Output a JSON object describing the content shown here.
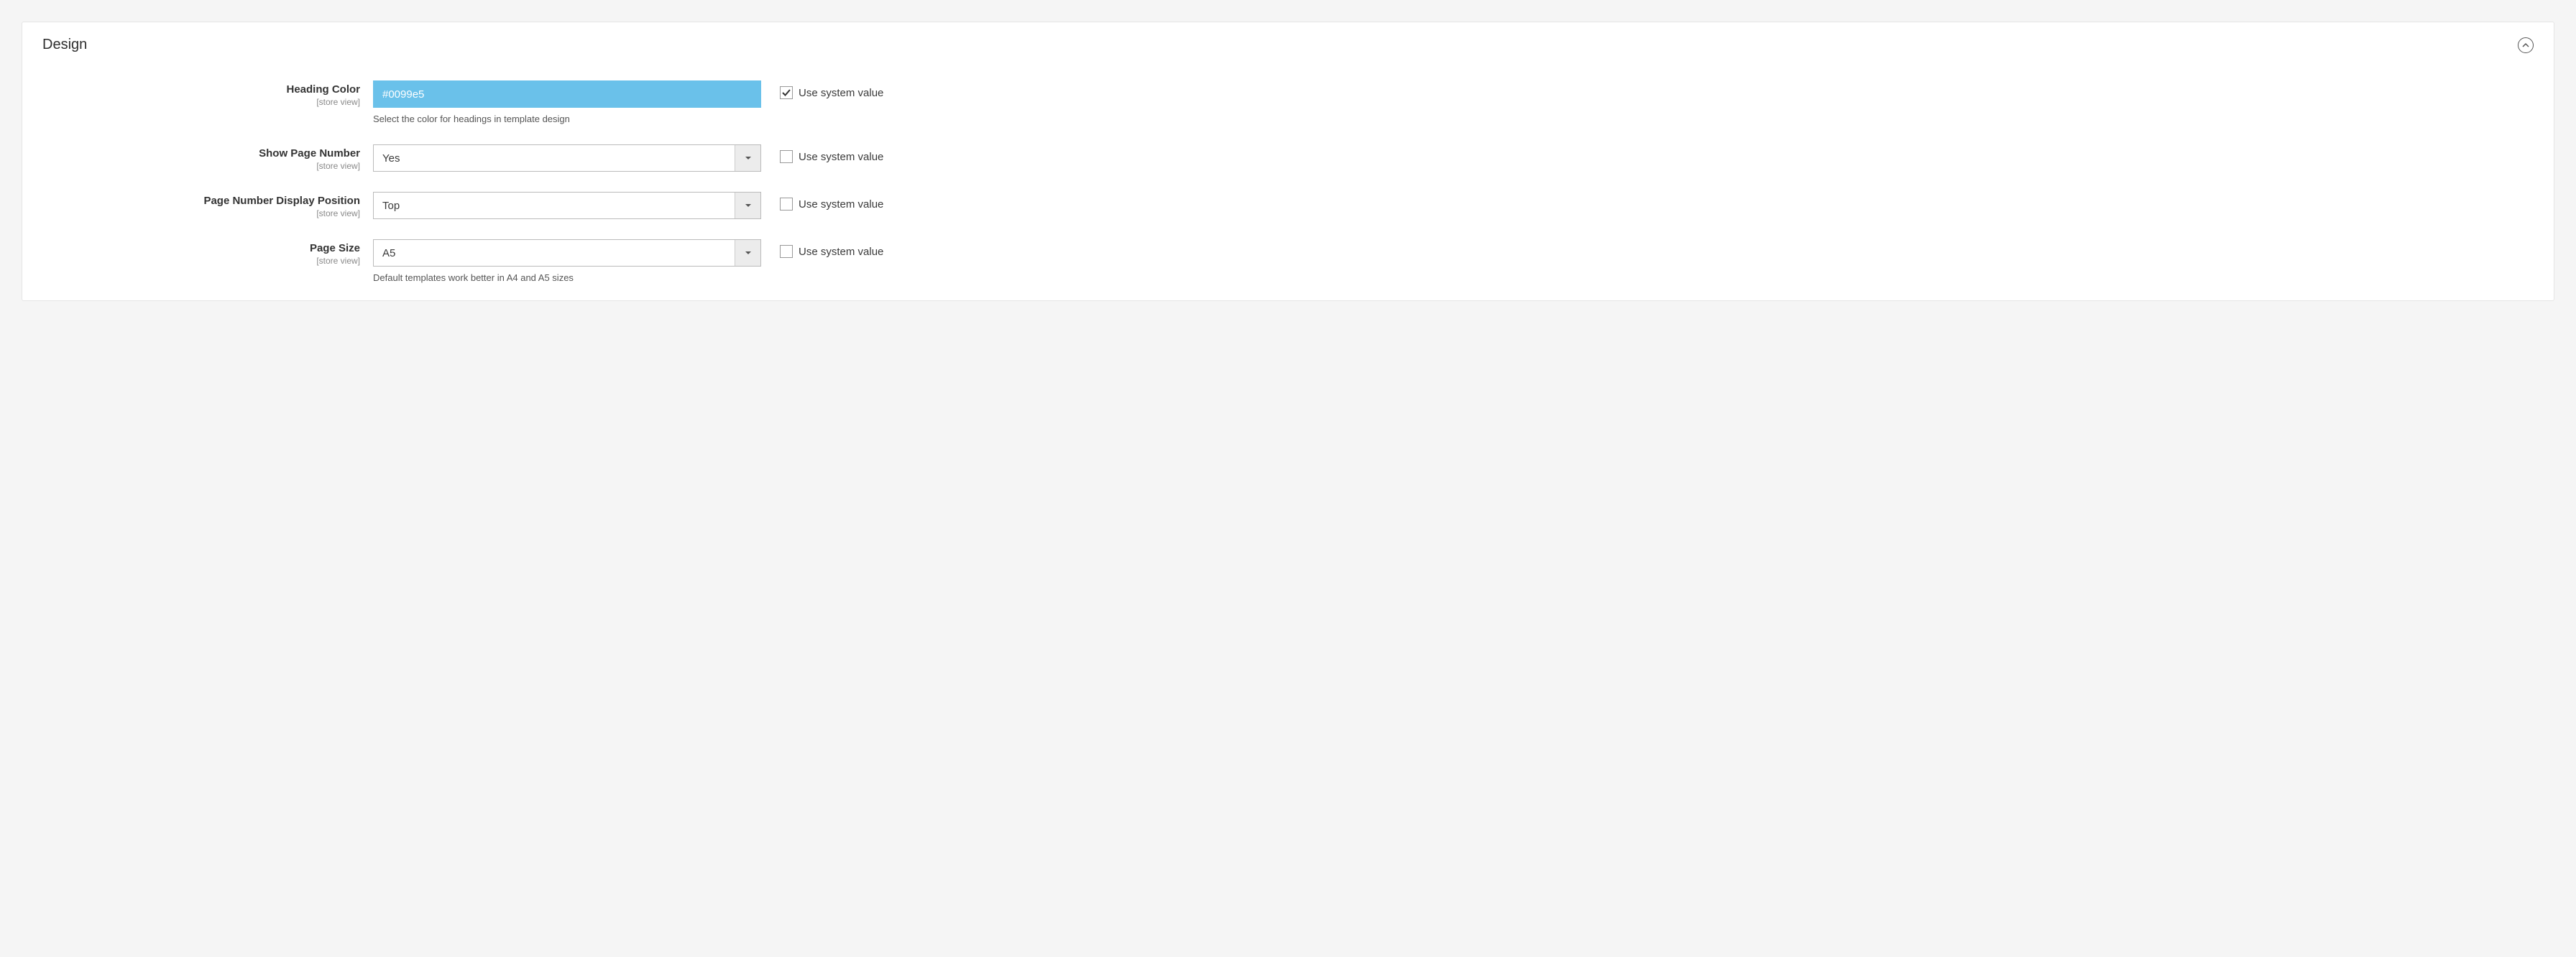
{
  "section": {
    "title": "Design",
    "scope_label": "[store view]",
    "use_system_value_label": "Use system value",
    "fields": {
      "heading_color": {
        "label": "Heading Color",
        "value": "#0099e5",
        "help": "Select the color for headings in template design",
        "use_system": true
      },
      "show_page_number": {
        "label": "Show Page Number",
        "value": "Yes",
        "use_system": false
      },
      "page_number_position": {
        "label": "Page Number Display Position",
        "value": "Top",
        "use_system": false
      },
      "page_size": {
        "label": "Page Size",
        "value": "A5",
        "help": "Default templates work better in A4 and A5 sizes",
        "use_system": false
      }
    }
  }
}
